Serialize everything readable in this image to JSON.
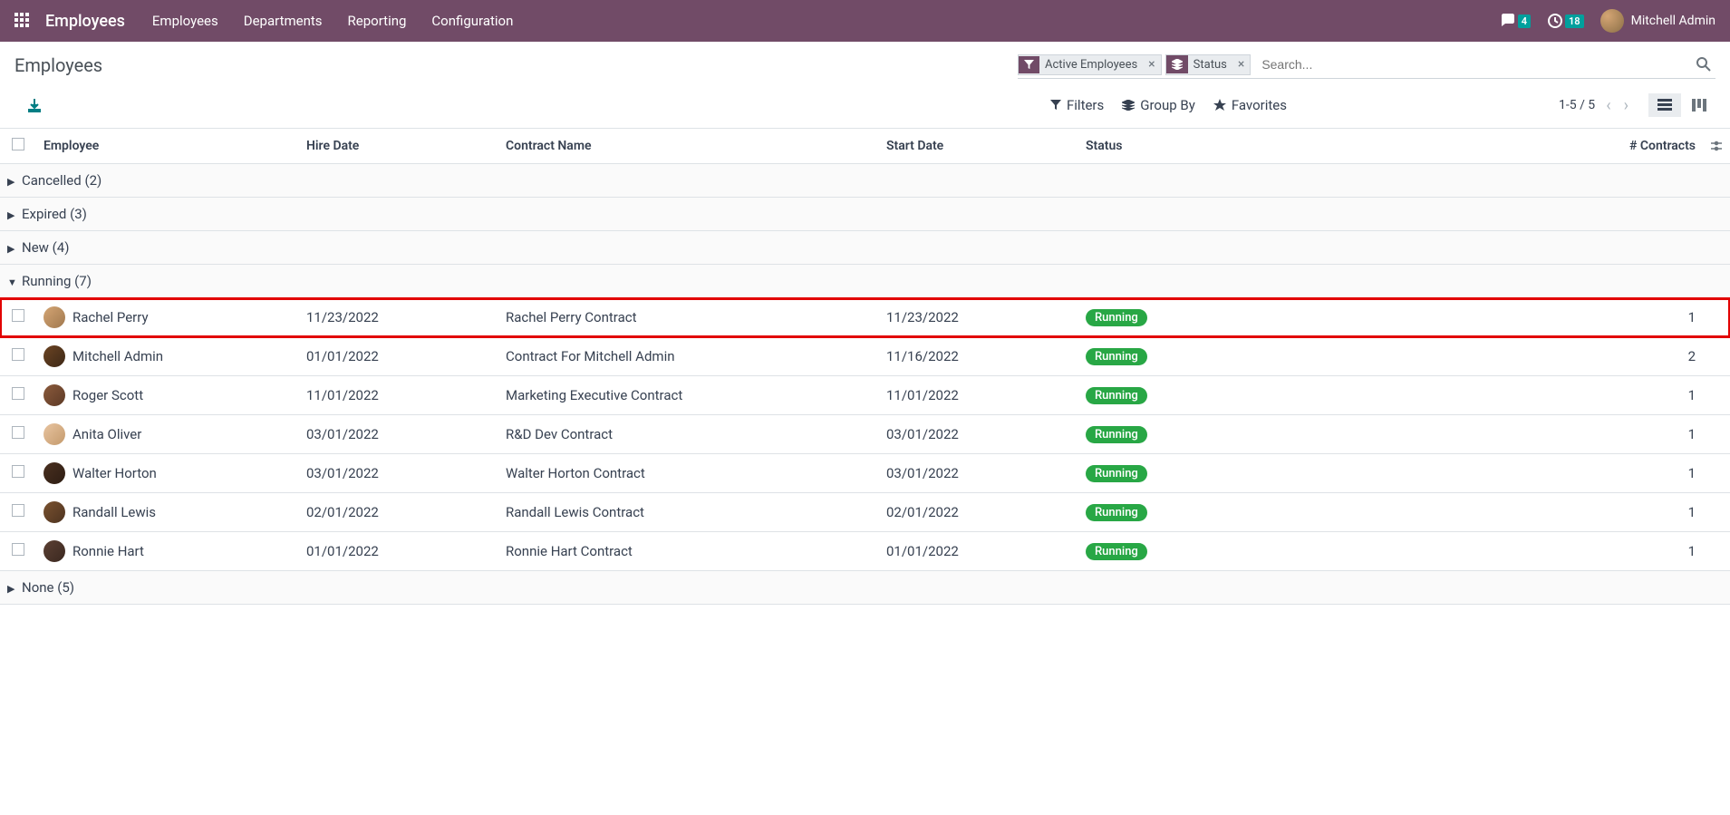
{
  "nav": {
    "brand": "Employees",
    "items": [
      "Employees",
      "Departments",
      "Reporting",
      "Configuration"
    ],
    "messages_badge": "4",
    "activities_badge": "18",
    "user_name": "Mitchell Admin"
  },
  "cp": {
    "breadcrumb": "Employees",
    "facets": [
      {
        "label": "Active Employees",
        "type": "filter"
      },
      {
        "label": "Status",
        "type": "groupby"
      }
    ],
    "search_placeholder": "Search...",
    "filters_label": "Filters",
    "groupby_label": "Group By",
    "favorites_label": "Favorites",
    "pager": "1-5 / 5"
  },
  "table": {
    "headers": {
      "employee": "Employee",
      "hire_date": "Hire Date",
      "contract_name": "Contract Name",
      "start_date": "Start Date",
      "status": "Status",
      "contracts": "# Contracts"
    },
    "groups": [
      {
        "label": "Cancelled",
        "count": "(2)",
        "expanded": false
      },
      {
        "label": "Expired",
        "count": "(3)",
        "expanded": false
      },
      {
        "label": "New",
        "count": "(4)",
        "expanded": false
      },
      {
        "label": "Running",
        "count": "(7)",
        "expanded": true
      },
      {
        "label": "None",
        "count": "(5)",
        "expanded": false
      }
    ],
    "rows": [
      {
        "employee": "Rachel Perry",
        "hire_date": "11/23/2022",
        "contract": "Rachel Perry Contract",
        "start_date": "11/23/2022",
        "status": "Running",
        "count": "1",
        "highlighted": true,
        "avatar": "a1"
      },
      {
        "employee": "Mitchell Admin",
        "hire_date": "01/01/2022",
        "contract": "Contract For Mitchell Admin",
        "start_date": "11/16/2022",
        "status": "Running",
        "count": "2",
        "avatar": "a2"
      },
      {
        "employee": "Roger Scott",
        "hire_date": "11/01/2022",
        "contract": "Marketing Executive Contract",
        "start_date": "11/01/2022",
        "status": "Running",
        "count": "1",
        "avatar": "a3"
      },
      {
        "employee": "Anita Oliver",
        "hire_date": "03/01/2022",
        "contract": "R&D Dev Contract",
        "start_date": "03/01/2022",
        "status": "Running",
        "count": "1",
        "avatar": "a4"
      },
      {
        "employee": "Walter Horton",
        "hire_date": "03/01/2022",
        "contract": "Walter Horton Contract",
        "start_date": "03/01/2022",
        "status": "Running",
        "count": "1",
        "avatar": "a5"
      },
      {
        "employee": "Randall Lewis",
        "hire_date": "02/01/2022",
        "contract": "Randall Lewis Contract",
        "start_date": "02/01/2022",
        "status": "Running",
        "count": "1",
        "avatar": "a6"
      },
      {
        "employee": "Ronnie Hart",
        "hire_date": "01/01/2022",
        "contract": "Ronnie Hart Contract",
        "start_date": "01/01/2022",
        "status": "Running",
        "count": "1",
        "avatar": "a7"
      }
    ]
  }
}
